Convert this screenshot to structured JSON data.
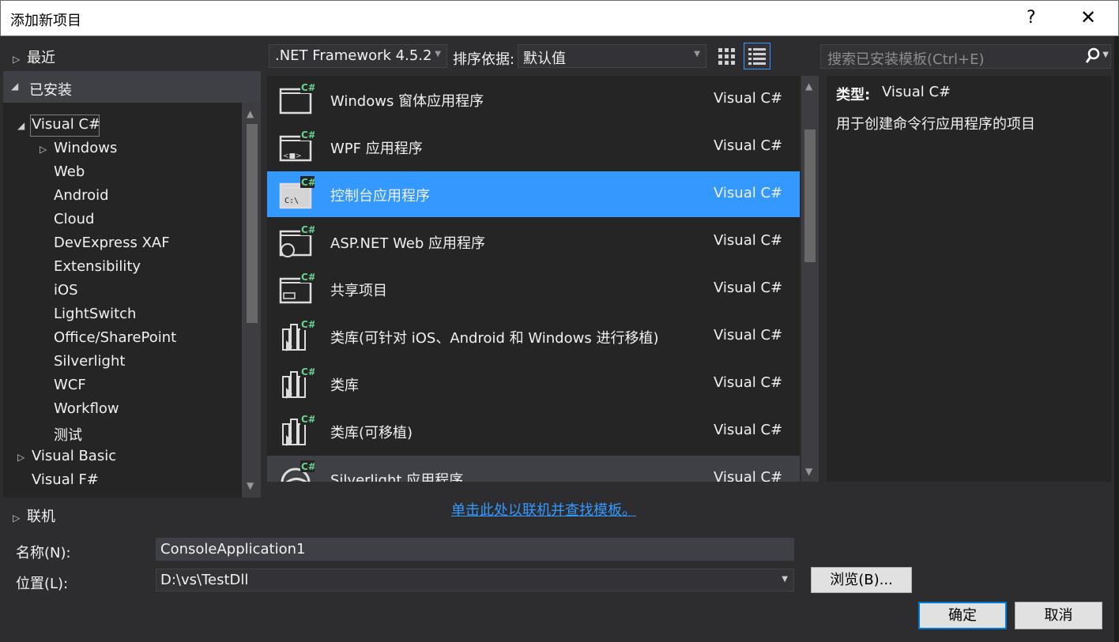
{
  "window": {
    "title": "添加新项目",
    "help": "?",
    "close": "✕"
  },
  "nav": {
    "recent": "最近",
    "installed": "已安装",
    "online": "联机",
    "tree": [
      {
        "label": "Visual C#",
        "expander": "◢"
      },
      {
        "label": "Windows",
        "expander": "▷"
      },
      {
        "label": "Web"
      },
      {
        "label": "Android"
      },
      {
        "label": "Cloud"
      },
      {
        "label": "DevExpress XAF"
      },
      {
        "label": "Extensibility"
      },
      {
        "label": "iOS"
      },
      {
        "label": "LightSwitch"
      },
      {
        "label": "Office/SharePoint"
      },
      {
        "label": "Silverlight"
      },
      {
        "label": "WCF"
      },
      {
        "label": "Workflow"
      },
      {
        "label": "测试"
      },
      {
        "label": "Visual Basic",
        "expander": "▷"
      },
      {
        "label": "Visual F#"
      }
    ]
  },
  "toolbar": {
    "framework": ".NET Framework 4.5.2",
    "sort_label": "排序依据:",
    "sort_value": "默认值",
    "search_placeholder": "搜索已安装模板(Ctrl+E)"
  },
  "templates": [
    {
      "name": "Windows 窗体应用程序",
      "lang": "Visual C#",
      "icon": "windows-forms-icon"
    },
    {
      "name": "WPF 应用程序",
      "lang": "Visual C#",
      "icon": "wpf-icon"
    },
    {
      "name": "控制台应用程序",
      "lang": "Visual C#",
      "icon": "console-icon"
    },
    {
      "name": "ASP.NET Web 应用程序",
      "lang": "Visual C#",
      "icon": "web-app-icon"
    },
    {
      "name": "共享项目",
      "lang": "Visual C#",
      "icon": "shared-project-icon"
    },
    {
      "name": "类库(可针对 iOS、Android 和 Windows 进行移植)",
      "lang": "Visual C#",
      "icon": "class-library-icon"
    },
    {
      "name": "类库",
      "lang": "Visual C#",
      "icon": "class-library-icon"
    },
    {
      "name": "类库(可移植)",
      "lang": "Visual C#",
      "icon": "class-library-icon"
    },
    {
      "name": "Silverlight 应用程序",
      "lang": "Visual C#",
      "icon": "silverlight-icon"
    }
  ],
  "selected_template_index": 2,
  "details": {
    "type_label": "类型:",
    "type_value": "Visual C#",
    "description": "用于创建命令行应用程序的项目"
  },
  "online_link": "单击此处以联机并查找模板。",
  "form": {
    "name_label": "名称(N):",
    "name_value": "ConsoleApplication1",
    "location_label": "位置(L):",
    "location_value": "D:\\vs\\TestDll",
    "browse": "浏览(B)...",
    "ok": "确定",
    "cancel": "取消"
  },
  "colors": {
    "accent": "#3399ff",
    "background": "#2d2d30",
    "csharp_badge": "#68d391"
  }
}
